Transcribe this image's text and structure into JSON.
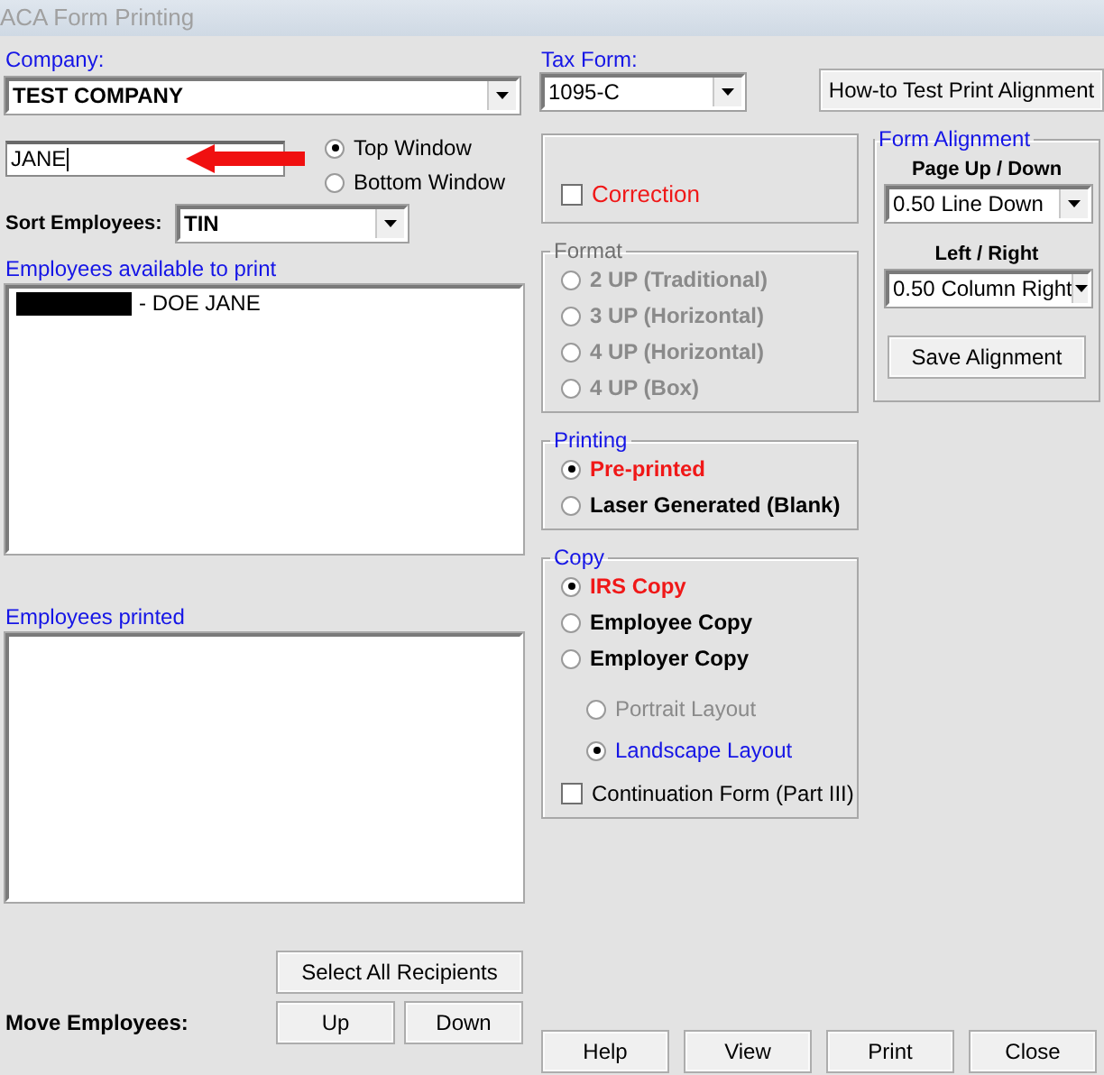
{
  "window": {
    "title": "ACA Form Printing"
  },
  "company": {
    "label": "Company:",
    "value": "TEST COMPANY"
  },
  "search": {
    "value": "JANE"
  },
  "window_choice": [
    {
      "label": "Top Window",
      "selected": true
    },
    {
      "label": "Bottom Window",
      "selected": false
    }
  ],
  "sort": {
    "label": "Sort Employees:",
    "value": "TIN"
  },
  "available": {
    "label": "Employees available to print",
    "items": [
      {
        "text": "- DOE JANE",
        "redacted": true
      }
    ]
  },
  "printed": {
    "label": "Employees printed"
  },
  "move": {
    "label": "Move Employees:",
    "buttons": [
      "Select  All Recipients",
      "Up",
      "Down"
    ]
  },
  "tax_form": {
    "label": "Tax Form:",
    "value": "1095-C"
  },
  "howto_button": "How-to Test Print Alignment",
  "correction": {
    "label": "Correction",
    "checked": false
  },
  "format": {
    "title": "Format",
    "options": [
      {
        "label": "2 UP (Traditional)",
        "selected": false,
        "disabled": true
      },
      {
        "label": "3 UP (Horizontal)",
        "selected": false,
        "disabled": true
      },
      {
        "label": "4 UP (Horizontal)",
        "selected": false,
        "disabled": true
      },
      {
        "label": "4 UP (Box)",
        "selected": false,
        "disabled": true
      }
    ]
  },
  "printing": {
    "title": "Printing",
    "options": [
      {
        "label": "Pre-printed",
        "selected": true,
        "disabled": false
      },
      {
        "label": "Laser Generated (Blank)",
        "selected": false,
        "disabled": false
      }
    ]
  },
  "copy": {
    "title": "Copy",
    "options": [
      {
        "label": "IRS Copy",
        "selected": true,
        "disabled": false
      },
      {
        "label": "Employee Copy",
        "selected": false,
        "disabled": false
      },
      {
        "label": "Employer Copy",
        "selected": false,
        "disabled": false
      }
    ],
    "layouts": [
      {
        "label": "Portrait Layout",
        "selected": false,
        "disabled": true
      },
      {
        "label": "Landscape Layout",
        "selected": true,
        "disabled": false
      }
    ],
    "continuation": {
      "label": "Continuation Form (Part III)",
      "checked": false
    }
  },
  "alignment": {
    "title": "Form Alignment",
    "page": {
      "label": "Page Up / Down",
      "value": "0.50 Line Down"
    },
    "side": {
      "label": "Left / Right",
      "value": "0.50 Column Right"
    },
    "button": "Save  Alignment"
  },
  "buttons": [
    "Help",
    "View",
    "Print",
    "Close"
  ]
}
